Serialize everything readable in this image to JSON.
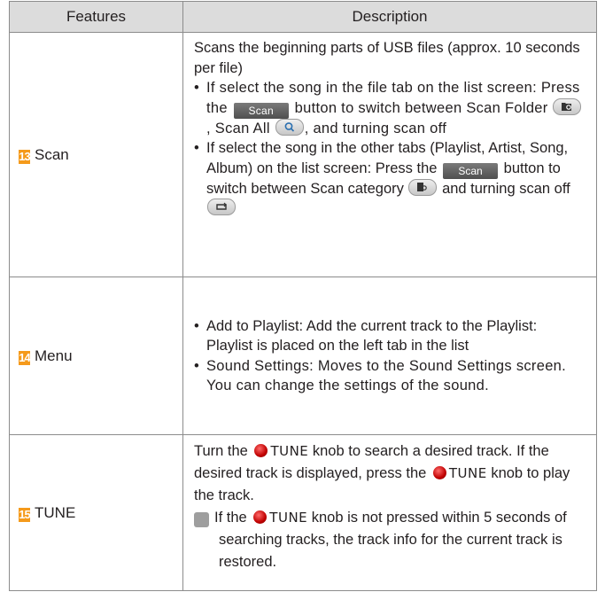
{
  "header": {
    "features": "Features",
    "description": "Description"
  },
  "rows": [
    {
      "num": "13",
      "feature": "Scan",
      "intro": "Scans the beginning parts of USB files (approx. 10 seconds per file)",
      "b1_pre": "If select the song in the file tab on the list screen: Press the",
      "scan_btn": "Scan",
      "b1_mid": "button to switch between Scan Folder",
      "b1_mid2": ", Scan All",
      "b1_end": ", and turning scan off",
      "b2_pre": "If select the song in the other tabs (Playlist, Artist, Song, Album) on the list screen: Press the",
      "b2_mid": "button to switch between Scan category",
      "b2_end": "and turning scan off"
    },
    {
      "num": "14",
      "feature": "Menu",
      "b1": "Add to Playlist: Add the current track to the Playlist: Playlist is placed on the left tab in the list",
      "b2": "Sound Settings: Moves to the Sound Settings screen. You can change the settings of the sound."
    },
    {
      "num": "15",
      "feature": "TUNE",
      "p1_pre": "Turn the",
      "tune": "TUNE",
      "p1_end": "knob to search a desired track. If the desired track is displayed, press the",
      "p1_end2": "knob to play the track.",
      "info_icon": "i",
      "note_pre": "If the",
      "note_end": "knob is not pressed within 5 seconds of searching tracks, the track info for the current track is restored."
    }
  ],
  "colors": {
    "number_badge": "#f59a1b",
    "header_bg": "#dcdcdc",
    "knob": "#c00000"
  }
}
